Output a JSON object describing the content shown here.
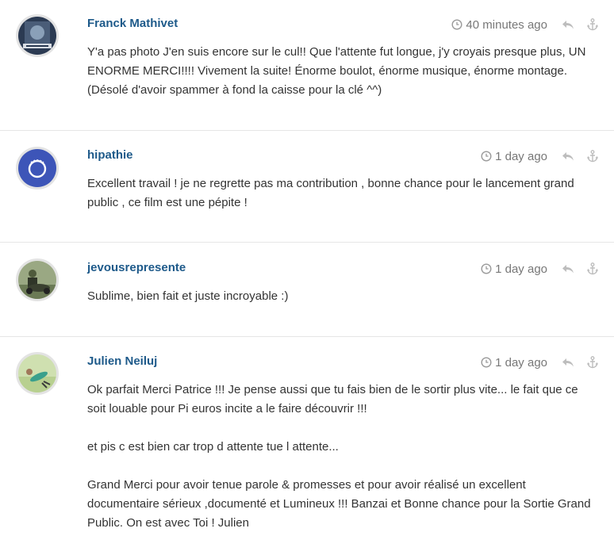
{
  "comments": [
    {
      "author": "Franck Mathivet",
      "time": "40 minutes ago",
      "avatar_colors": [
        "#2b3a52",
        "#8aa0b8"
      ],
      "paragraphs": [
        "Y'a pas photo J'en suis encore sur le cul!! Que l'attente fut longue, j'y croyais presque plus, UN ENORME MERCI!!!! Vivement la suite! Énorme boulot, énorme musique, énorme montage. (Désolé d'avoir spammer à fond la caisse pour la clé ^^)"
      ]
    },
    {
      "author": "hipathie",
      "time": "1 day ago",
      "avatar_colors": [
        "#3d55b8",
        "#ffffff"
      ],
      "paragraphs": [
        "Excellent travail ! je ne regrette pas ma contribution , bonne chance pour le lancement grand public , ce film est une pépite !"
      ]
    },
    {
      "author": "jevousrepresente",
      "time": "1 day ago",
      "avatar_colors": [
        "#4f5b3c",
        "#9aa883"
      ],
      "paragraphs": [
        "Sublime, bien fait et juste incroyable :)"
      ]
    },
    {
      "author": "Julien Neiluj",
      "time": "1 day ago",
      "avatar_colors": [
        "#cfe0b0",
        "#3aa08c"
      ],
      "paragraphs": [
        "Ok parfait Merci Patrice !!! Je pense aussi que tu fais bien de le sortir plus vite... le fait que ce soit louable pour Pi euros incite a le faire découvrir !!!",
        "et pis c est bien car trop d attente tue l attente...",
        "Grand Merci pour avoir tenue parole & promesses et pour avoir réalisé un excellent documentaire sérieux ,documenté et Lumineux !!! Banzai et Bonne chance pour la Sortie Grand Public. On est avec Toi ! Julien"
      ]
    }
  ],
  "colors": {
    "author": "#1e5a8a",
    "meta": "#777777",
    "body_text": "#333333",
    "separator": "#e6e6e6"
  },
  "icons": {
    "time": "clock-icon",
    "reply": "reply-icon",
    "permalink": "anchor-icon"
  }
}
